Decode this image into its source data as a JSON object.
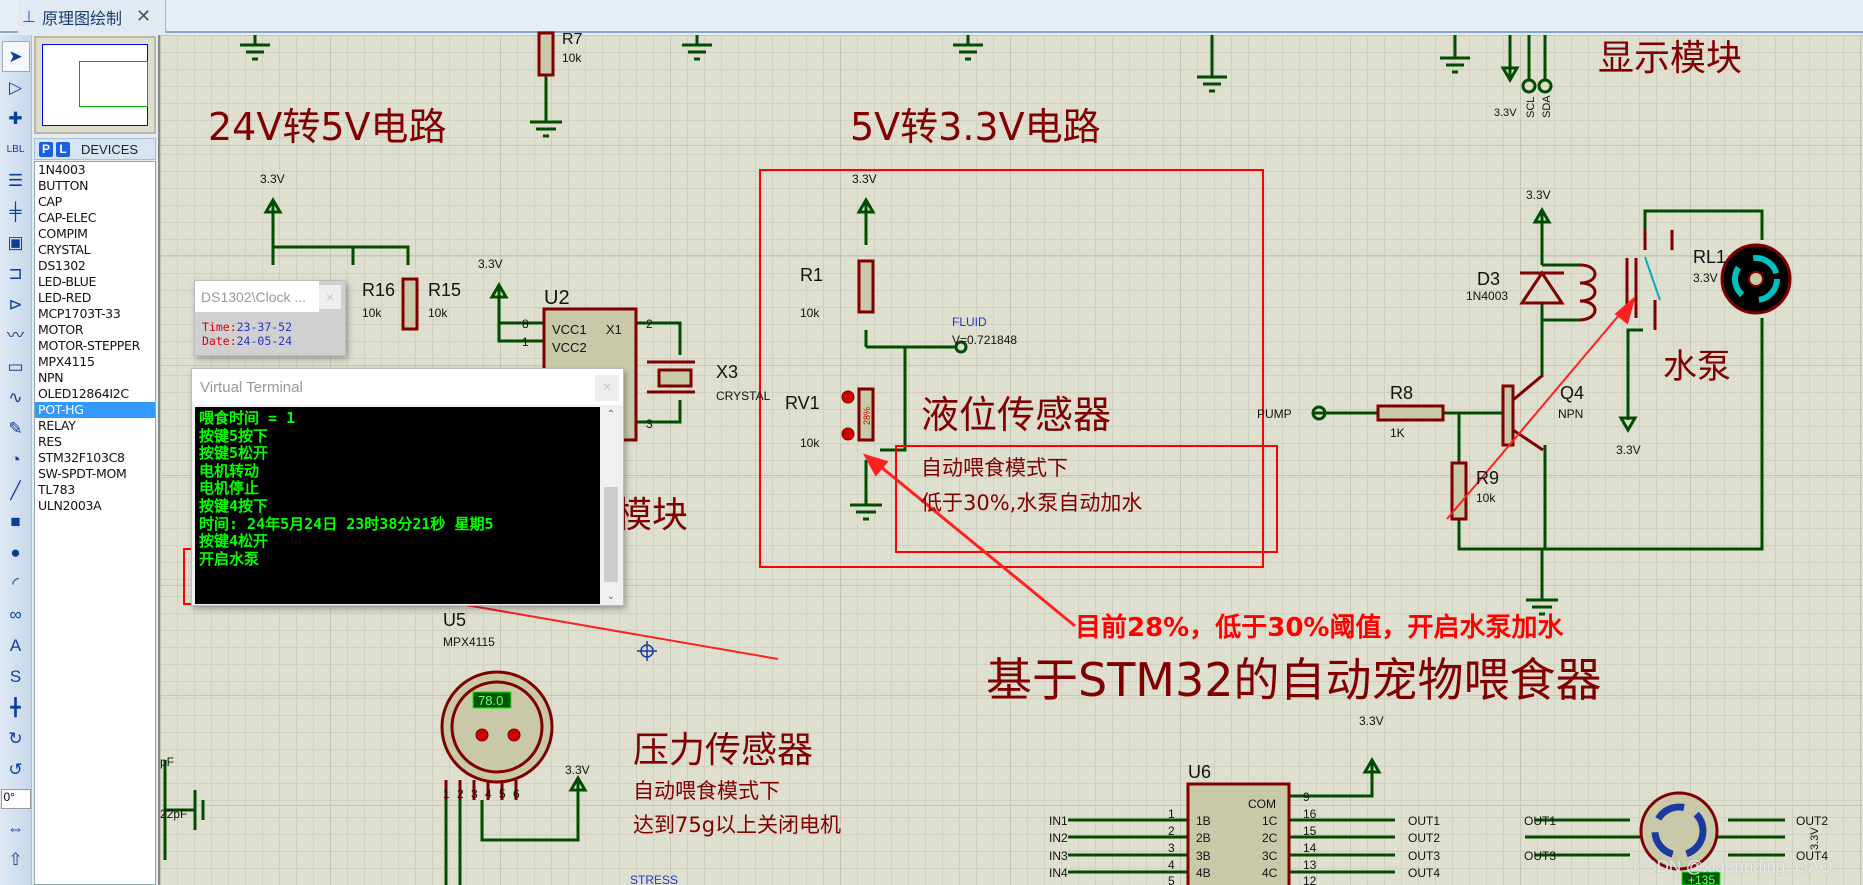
{
  "tab": {
    "title": "原理图绘制",
    "close": "✕"
  },
  "toolbar": {
    "tools": [
      {
        "name": "selection-mode-icon",
        "glyph": "➤"
      },
      {
        "name": "component-mode-icon",
        "glyph": "▷"
      },
      {
        "name": "junction-dot-icon",
        "glyph": "✚"
      },
      {
        "name": "wire-label-icon",
        "glyph": "LBL"
      },
      {
        "name": "text-script-icon",
        "glyph": "☰"
      },
      {
        "name": "buses-icon",
        "glyph": "╪"
      },
      {
        "name": "subcircuit-icon",
        "glyph": "▣"
      },
      {
        "name": "terminals-icon",
        "glyph": "⊐"
      },
      {
        "name": "device-pins-icon",
        "glyph": "⊳"
      },
      {
        "name": "graph-icon",
        "glyph": "〰"
      },
      {
        "name": "tape-recorder-icon",
        "glyph": "▭"
      },
      {
        "name": "generator-icon",
        "glyph": "∿"
      },
      {
        "name": "probe-icon",
        "glyph": "✎"
      },
      {
        "name": "virtual-instrument-icon",
        "glyph": "◔"
      },
      {
        "name": "line-icon",
        "glyph": "╱"
      },
      {
        "name": "box-icon",
        "glyph": "■"
      },
      {
        "name": "circle-icon",
        "glyph": "●"
      },
      {
        "name": "arc-icon",
        "glyph": "◜"
      },
      {
        "name": "path-icon",
        "glyph": "∞"
      },
      {
        "name": "text-icon",
        "glyph": "A"
      },
      {
        "name": "symbol-icon",
        "glyph": "S"
      },
      {
        "name": "marker-icon",
        "glyph": "╋"
      },
      {
        "name": "rotate-clockwise-icon",
        "glyph": "↻"
      },
      {
        "name": "rotate-anticlockwise-icon",
        "glyph": "↺"
      }
    ],
    "angle": "0°",
    "tools2": [
      {
        "name": "mirror-horizontal-icon",
        "glyph": "⇔"
      },
      {
        "name": "mirror-vertical-icon",
        "glyph": "⇧"
      }
    ]
  },
  "devices": {
    "p": "P",
    "l": "L",
    "header": "DEVICES",
    "selected": "POT-HG",
    "items": [
      "1N4003",
      "BUTTON",
      "CAP",
      "CAP-ELEC",
      "COMPIM",
      "CRYSTAL",
      "DS1302",
      "LED-BLUE",
      "LED-RED",
      "MCP1703T-33",
      "MOTOR",
      "MOTOR-STEPPER",
      "MPX4115",
      "NPN",
      "OLED12864I2C",
      "POT-HG",
      "RELAY",
      "RES",
      "STM32F103C8",
      "SW-SPDT-MOM",
      "TL783",
      "ULN2003A"
    ]
  },
  "clock": {
    "title": "DS1302\\Clock ...",
    "close": "×",
    "time_label": "Time:",
    "time": "23-37-52",
    "date_label": "Date:",
    "date": "24-05-24"
  },
  "terminal": {
    "title": "Virtual Terminal",
    "close": "×",
    "lines": [
      "喂食时间 = 1",
      "按键5按下",
      "按键5松开",
      "电机转动",
      "电机停止",
      "按键4按下",
      "时间: 24年5月24日 23时38分21秒 星期5",
      "按键4松开",
      "开启水泵"
    ]
  },
  "canvas": {
    "heading_24v": "24V转5V电路",
    "heading_5v": "5V转3.3V电路",
    "heading_display": "显示模块",
    "heading_module": "模块",
    "heading_level": "液位传感器",
    "level_note1": "自动喂食模式下",
    "level_note2": "低于30%,水泵自动加水",
    "annotation": "目前28%，低于30%阈值，开启水泵加水",
    "title": "基于STM32的自动宠物喂食器",
    "heading_pressure": "压力传感器",
    "pressure_note1": "自动喂食模式下",
    "pressure_note2": "达到75g以上关闭电机",
    "pump_label": "水泵",
    "watermark": "CSDN @xiaobuding_QAQ"
  },
  "parts": {
    "r7": [
      "R7",
      "10k"
    ],
    "r16": [
      "R16",
      "10k"
    ],
    "r15": [
      "R15",
      "10k"
    ],
    "u2": {
      "name": "U2",
      "p1": "VCC1",
      "p2": "VCC2",
      "p3": "X1",
      "n8": "8",
      "n1": "1",
      "n2": "2",
      "n3": "3"
    },
    "x3": [
      "X3",
      "CRYSTAL"
    ],
    "r1": [
      "R1",
      "10k"
    ],
    "rv1": [
      "RV1",
      "10k",
      "28%"
    ],
    "fluid": {
      "probe": "FLUID",
      "voltage": "V=0.721848",
      "term": "FLUID"
    },
    "d3": [
      "D3",
      "1N4003"
    ],
    "rl1": [
      "RL1",
      "3.3V"
    ],
    "q4": [
      "Q4",
      "NPN"
    ],
    "r8": [
      "R8",
      "1K"
    ],
    "r9": [
      "R9",
      "10k"
    ],
    "pump": "PUMP",
    "u5": {
      "name": "U5",
      "type": "MPX4115",
      "reading": "78.0",
      "pins": [
        "1",
        "2",
        "3",
        "4",
        "5",
        "6"
      ]
    },
    "stress": "STRESS",
    "cap": [
      "pF",
      "22pF"
    ],
    "u6": {
      "name": "U6",
      "com": "COM",
      "pins": [
        "9",
        "16",
        "15",
        "14",
        "13",
        "12"
      ],
      "in": [
        "1B",
        "2B",
        "3B",
        "4B"
      ],
      "out": [
        "1C",
        "2C",
        "3C",
        "4C"
      ],
      "innum": [
        "1",
        "2",
        "3",
        "4",
        "5"
      ],
      "inputs": [
        "IN1",
        "IN2",
        "IN3",
        "IN4"
      ],
      "outputs": [
        "OUT1",
        "OUT2",
        "OUT3",
        "OUT4"
      ]
    },
    "stepper": {
      "left": [
        "OUT1",
        "OUT3"
      ],
      "right": [
        "OUT2",
        "OUT4"
      ],
      "v": "3.3V",
      "angle": "+135"
    },
    "vcc": "3.3V",
    "scl": "SCL",
    "sda": "SDA"
  },
  "colors": {
    "wire": "#004d00",
    "part": "#800000",
    "annotation": "#ff0000",
    "terminal_text": "#00ff00",
    "selected": "#3399ff"
  }
}
